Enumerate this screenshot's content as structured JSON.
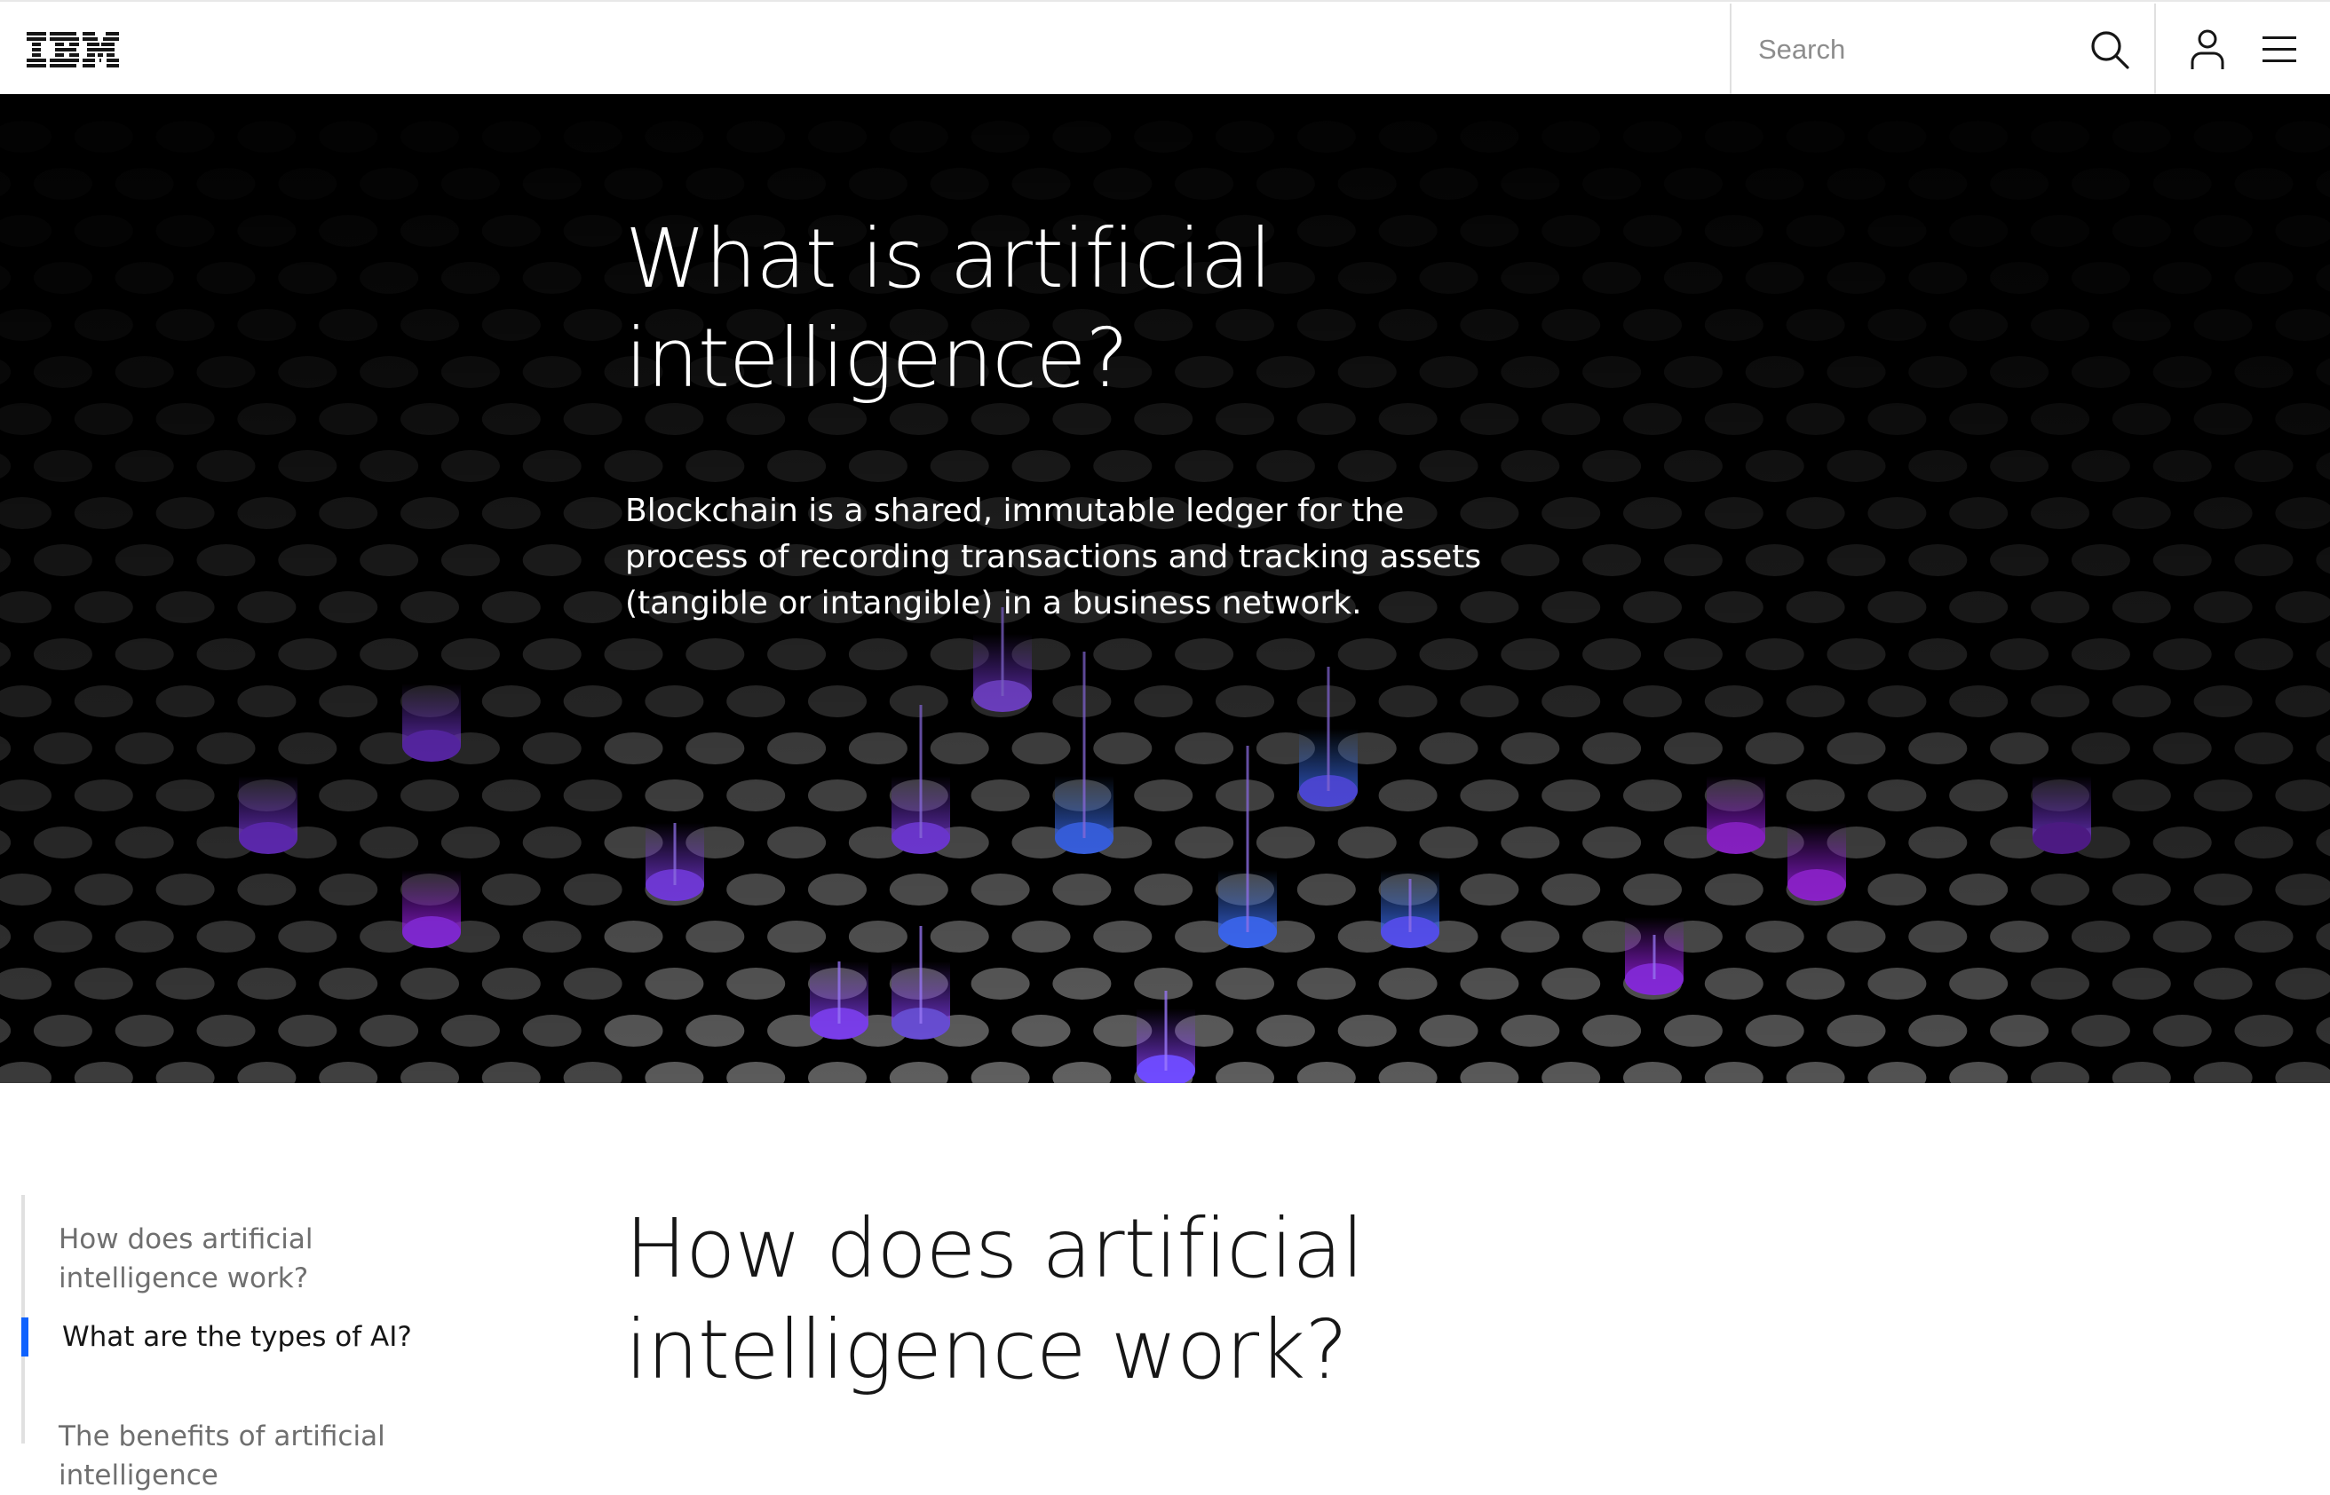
{
  "header": {
    "logo_text": "IBM",
    "search_placeholder": "Search",
    "icons": [
      "search-icon",
      "user-icon",
      "menu-icon"
    ]
  },
  "hero": {
    "title": "What is artificial intelligence?",
    "description": "Blockchain is a shared, immutable ledger for the process of recording transactions and tracking assets (tangible or intangible) in a business network.",
    "colors": {
      "background": "#000000",
      "purple": "#8a3ffc",
      "blue": "#4589ff",
      "magenta": "#a020f0"
    }
  },
  "toc": {
    "items": [
      {
        "label": "How does artificial intelligence work?",
        "active": false
      },
      {
        "label": "What are the types of AI?",
        "active": true
      },
      {
        "label": "The benefits of artificial intelligence",
        "active": false
      }
    ],
    "accent": "#0f62fe"
  },
  "main": {
    "section_title": "How does artificial intelligence work?"
  }
}
